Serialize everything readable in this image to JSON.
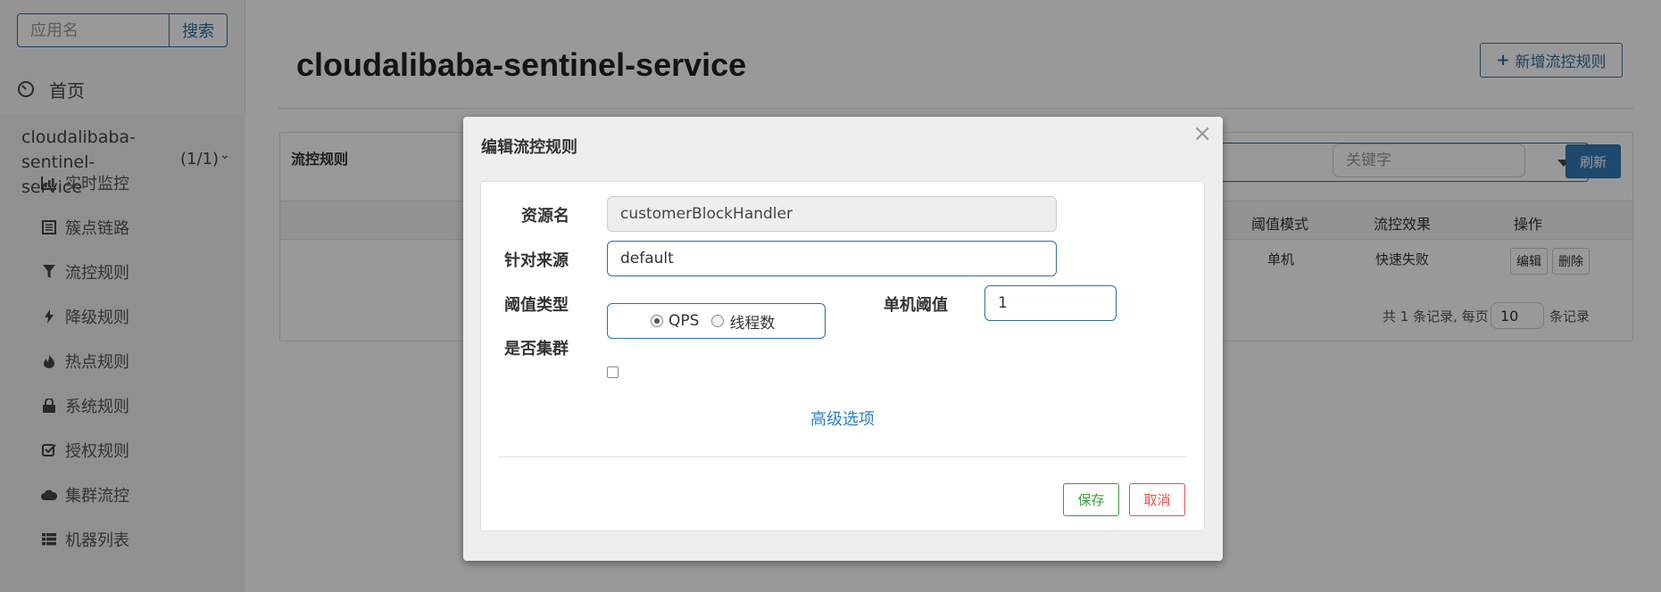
{
  "sidebar": {
    "search_placeholder": "应用名",
    "search_button": "搜索",
    "home_label": "首页",
    "app": {
      "name_line1": "cloudalibaba-sentinel-",
      "name_line2": "service",
      "count": "(1/1)"
    },
    "items": [
      {
        "label": "实时监控",
        "icon": "bar-chart-icon"
      },
      {
        "label": "簇点链路",
        "icon": "list-icon"
      },
      {
        "label": "流控规则",
        "icon": "filter-icon"
      },
      {
        "label": "降级规则",
        "icon": "flash-icon"
      },
      {
        "label": "热点规则",
        "icon": "fire-icon"
      },
      {
        "label": "系统规则",
        "icon": "lock-icon"
      },
      {
        "label": "授权规则",
        "icon": "check-square-icon"
      },
      {
        "label": "集群流控",
        "icon": "cloud-icon"
      },
      {
        "label": "机器列表",
        "icon": "th-list-icon"
      }
    ]
  },
  "main": {
    "title": "cloudalibaba-sentinel-service",
    "add_button": "新增流控规则",
    "panel": {
      "title": "流控规则",
      "keyword_placeholder": "关键字",
      "refresh_button": "刷新",
      "headers": [
        "阈值模式",
        "流控效果",
        "操作"
      ],
      "row": {
        "mode": "单机",
        "effect": "快速失败",
        "edit": "编辑",
        "delete": "删除"
      },
      "pager": {
        "prefix": "共 1 条记录, 每页",
        "page_size": "10",
        "suffix": "条记录"
      }
    }
  },
  "modal": {
    "title": "编辑流控规则",
    "close": "×",
    "resource_label": "资源名",
    "resource_value": "customerBlockHandler",
    "source_label": "针对来源",
    "source_value": "default",
    "threshold_type_label": "阈值类型",
    "threshold_type_options": [
      "QPS",
      "线程数"
    ],
    "threshold_type_selected": "QPS",
    "single_threshold_label": "单机阈值",
    "single_threshold_value": "1",
    "cluster_label": "是否集群",
    "cluster_checked": false,
    "advanced_link": "高级选项",
    "save_button": "保存",
    "cancel_button": "取消"
  },
  "colors": {
    "primary": "#337ab7",
    "save": "#3c9a3c",
    "cancel": "#d9534f",
    "link": "#2a7fc7"
  }
}
